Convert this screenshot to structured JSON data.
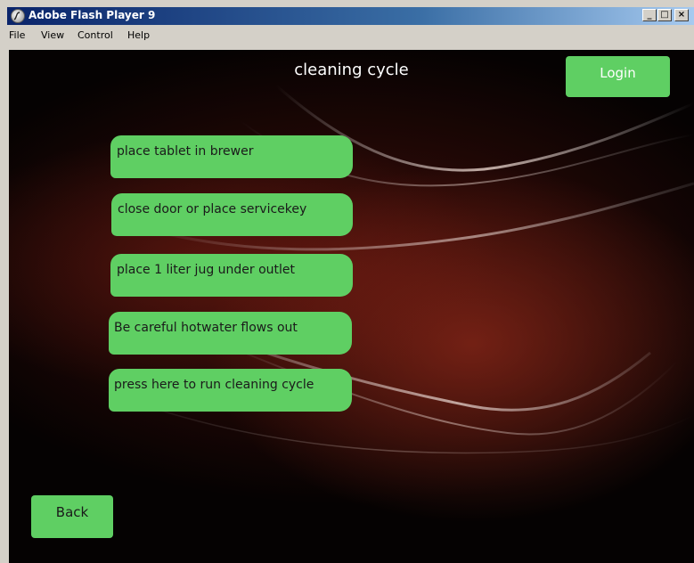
{
  "window": {
    "title": "Adobe Flash Player 9",
    "controls": {
      "minimize": "_",
      "maximize": "□",
      "close": "×"
    }
  },
  "menubar": {
    "items": [
      "File",
      "View",
      "Control",
      "Help"
    ]
  },
  "screen": {
    "title": "cleaning cycle",
    "login_label": "Login",
    "back_label": "Back",
    "steps": [
      "place tablet in brewer",
      "close door or place servicekey",
      "place 1 liter jug under outlet",
      "Be careful hotwater flows out",
      "press here to run cleaning cycle"
    ]
  },
  "colors": {
    "button_green": "#5fcf63",
    "background": "#050202",
    "accent_red": "#8c2819"
  },
  "icons": [
    "flash-player-icon"
  ]
}
